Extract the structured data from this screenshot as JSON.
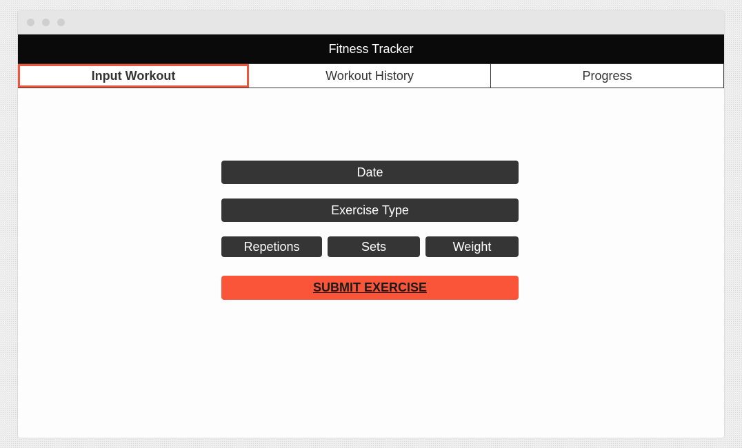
{
  "app": {
    "title": "Fitness Tracker"
  },
  "tabs": [
    {
      "label": "Input Workout",
      "active": true
    },
    {
      "label": "Workout History",
      "active": false
    },
    {
      "label": "Progress",
      "active": false
    }
  ],
  "form": {
    "date_label": "Date",
    "exercise_type_label": "Exercise Type",
    "repetitions_label": "Repetions",
    "sets_label": "Sets",
    "weight_label": "Weight",
    "submit_label": "SUBMIT EXERCISE"
  },
  "colors": {
    "header_bg": "#0a0a0a",
    "field_bg": "#353535",
    "accent": "#fa5538",
    "active_tab_outline": "#f0543a"
  }
}
